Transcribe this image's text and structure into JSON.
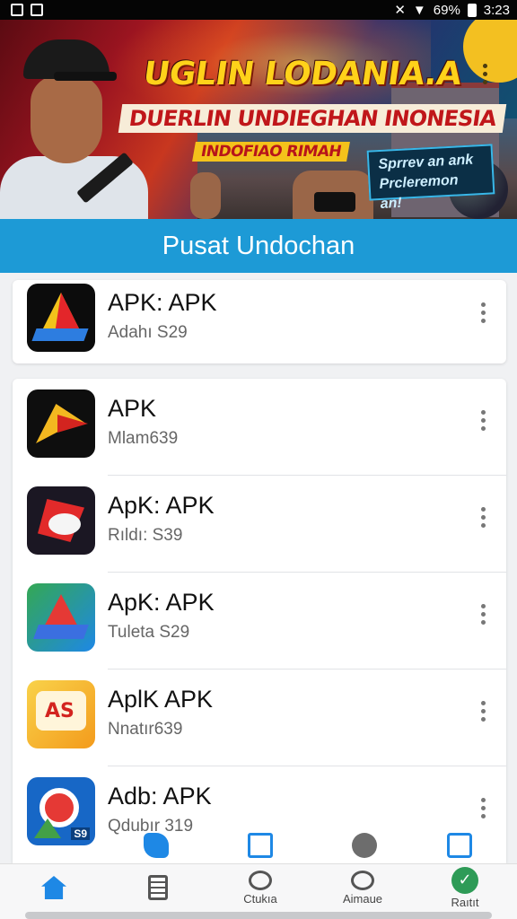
{
  "status_bar": {
    "battery": "69%",
    "time": "3:23"
  },
  "banner": {
    "headline": "UGLIN LODANIA.A",
    "subline": "DUERLIN UNDIEGHAN INONESIA",
    "tagline": "INDOFIAO RIMAH",
    "promo_line1": "Sprrev an ank",
    "promo_line2": "Prcleremon an!"
  },
  "section_title": "Pusat Undochan",
  "apps": [
    {
      "name": "APK: APK",
      "sub": "Adahı S29",
      "icon": "triangle-logo-icon"
    },
    {
      "name": "APK",
      "sub": "Mlam639",
      "icon": "hawk-logo-icon"
    },
    {
      "name": "ApK: APK",
      "sub": "Rıldı: S39",
      "icon": "rider-logo-icon"
    },
    {
      "name": "ApK: APK",
      "sub": "Tuleta S29",
      "icon": "drive-logo-icon"
    },
    {
      "name": "AplK APK",
      "sub": "Nnatır639",
      "icon": "chat-logo-icon"
    },
    {
      "name": "Adb: APK",
      "sub": "Qdubır 319",
      "icon": "pin-logo-icon"
    }
  ],
  "bottom_nav": {
    "home": "",
    "docs": "",
    "chat": "Ctukıa",
    "status": "Aimaue",
    "report": "Raıtıt"
  },
  "colors": {
    "accent": "#1d9ad6",
    "nav_icon": "#1e88e5"
  }
}
